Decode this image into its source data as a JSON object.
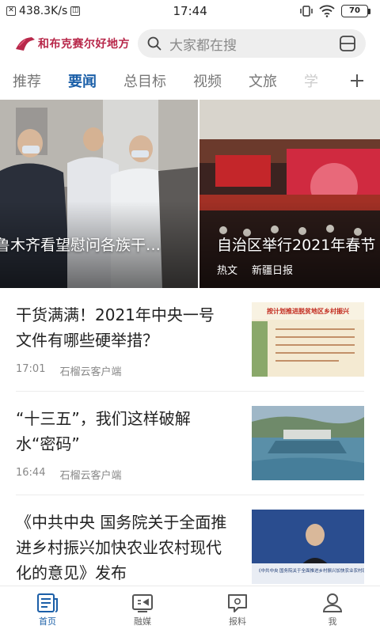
{
  "status_bar": {
    "speed": "438.3K/s",
    "time": "17:44",
    "battery": "70"
  },
  "header": {
    "logo_text": "和布克赛尔好地方",
    "search_placeholder": "大家都在搜",
    "brand_color": "#b8284a"
  },
  "tabs": [
    {
      "label": "推荐"
    },
    {
      "label": "要闻"
    },
    {
      "label": "总目标"
    },
    {
      "label": "视频"
    },
    {
      "label": "文旅"
    },
    {
      "label": "学"
    }
  ],
  "active_tab": "要闻",
  "carousel": [
    {
      "caption": "鲁木齐看望慰问各族干…"
    },
    {
      "caption": "自治区举行2021年春节",
      "tag": "热文",
      "source": "新疆日报"
    }
  ],
  "news": [
    {
      "title": "干货满满！2021年中央一号文件有哪些硬举措？",
      "time": "17:01",
      "source": "石榴云客户端",
      "thumb_text": "按计划推进脱贫地区乡村振兴"
    },
    {
      "title": "“十三五”，我们这样破解水“密码”",
      "time": "16:44",
      "source": "石榴云客户端"
    },
    {
      "title": "《中共中央 国务院关于全面推进乡村振兴加快农业农村现代化的意见》发布",
      "thumb_text": "《中共中央 国务院关于全面推进乡村振兴加快农业农村现代化的意见》发布"
    }
  ],
  "bottom_nav": [
    {
      "label": "首页",
      "icon": "newspaper-icon"
    },
    {
      "label": "融媒",
      "icon": "media-icon"
    },
    {
      "label": "报料",
      "icon": "report-icon"
    },
    {
      "label": "我",
      "icon": "person-icon"
    }
  ],
  "accent_color": "#1b5fa8"
}
